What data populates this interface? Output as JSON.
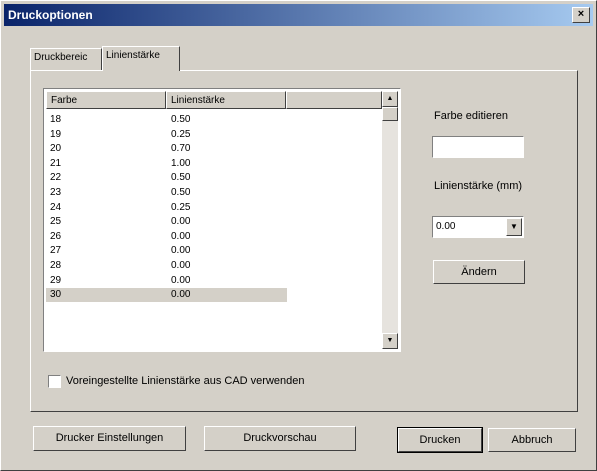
{
  "window": {
    "title": "Druckoptionen",
    "close_glyph": "×"
  },
  "tabs": [
    {
      "label": "Druckbereic"
    },
    {
      "label": "Linienstärke"
    }
  ],
  "list": {
    "columns": [
      "Farbe",
      "Linienstärke"
    ],
    "rows": [
      {
        "farbe": "18",
        "staerke": "0.50"
      },
      {
        "farbe": "19",
        "staerke": "0.25"
      },
      {
        "farbe": "20",
        "staerke": "0.70"
      },
      {
        "farbe": "21",
        "staerke": "1.00"
      },
      {
        "farbe": "22",
        "staerke": "0.50"
      },
      {
        "farbe": "23",
        "staerke": "0.50"
      },
      {
        "farbe": "24",
        "staerke": "0.25"
      },
      {
        "farbe": "25",
        "staerke": "0.00"
      },
      {
        "farbe": "26",
        "staerke": "0.00"
      },
      {
        "farbe": "27",
        "staerke": "0.00"
      },
      {
        "farbe": "28",
        "staerke": "0.00"
      },
      {
        "farbe": "29",
        "staerke": "0.00"
      },
      {
        "farbe": "30",
        "staerke": "0.00"
      }
    ],
    "selected_index": 12,
    "scroll_up_glyph": "▲",
    "scroll_down_glyph": "▼"
  },
  "edit": {
    "farbe_label": "Farbe editieren",
    "farbe_value": "",
    "staerke_label": "Linienstärke (mm)",
    "staerke_value": "0.00",
    "dropdown_glyph": "▼",
    "aendern_button": "Ändern"
  },
  "checkbox": {
    "label": "Voreingestellte Linienstärke aus CAD verwenden",
    "checked": false
  },
  "footer": {
    "drucker_einstellungen": "Drucker Einstellungen",
    "druckvorschau": "Druckvorschau",
    "drucken": "Drucken",
    "abbruch": "Abbruch"
  }
}
